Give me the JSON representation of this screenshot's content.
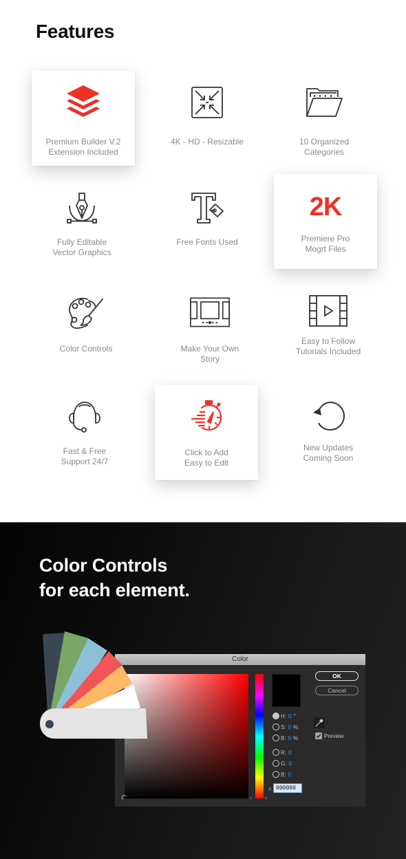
{
  "features": {
    "title": "Features",
    "items": [
      {
        "icon": "layers-icon",
        "lines": [
          "Premium Builder V.2",
          "Extension Included"
        ],
        "highlighted": true
      },
      {
        "icon": "resize-arrows-icon",
        "lines": [
          "4K - HD - Resizable"
        ],
        "highlighted": false
      },
      {
        "icon": "folder-icon",
        "lines": [
          "10 Organized",
          "Categories"
        ],
        "highlighted": false
      },
      {
        "icon": "pen-tool-icon",
        "lines": [
          "Fully Editable",
          "Vector Graphics"
        ],
        "highlighted": false
      },
      {
        "icon": "font-pen-icon",
        "lines": [
          "Free Fonts Used"
        ],
        "highlighted": false
      },
      {
        "icon": "2k-badge",
        "badge_text": "2K",
        "lines": [
          "Premiere Pro",
          "Mogrt Files"
        ],
        "highlighted": true
      },
      {
        "icon": "palette-icon",
        "lines": [
          "Color Controls"
        ],
        "highlighted": false
      },
      {
        "icon": "slideshow-icon",
        "lines": [
          "Make Your Own",
          "Story"
        ],
        "highlighted": false
      },
      {
        "icon": "film-play-icon",
        "lines": [
          "Easy to Follow",
          "Tutorials Included"
        ],
        "highlighted": false
      },
      {
        "icon": "headset-icon",
        "lines": [
          "Fast & Free",
          "Support 24/7"
        ],
        "highlighted": false
      },
      {
        "icon": "stopwatch-icon",
        "lines": [
          "Click to Add",
          "Easy to Edit"
        ],
        "highlighted": true
      },
      {
        "icon": "refresh-icon",
        "lines": [
          "New Updates",
          "Coming Soon"
        ],
        "highlighted": false
      }
    ]
  },
  "colors": {
    "accent": "#ee3127",
    "label_gray": "#8a8a8a",
    "swatches": [
      "#3a4654",
      "#7aa766",
      "#8cc0d8",
      "#f25555",
      "#ffb866",
      "#ffffff",
      "#e4e4e4"
    ]
  },
  "color_section": {
    "title_lines": [
      "Color Controls",
      "for each element."
    ]
  },
  "color_dialog": {
    "title": "Color",
    "ok_label": "OK",
    "cancel_label": "Cancel",
    "hsb": [
      {
        "label": "H:",
        "value": "0",
        "unit": "°",
        "checked": true
      },
      {
        "label": "S:",
        "value": "0",
        "unit": "%",
        "checked": false
      },
      {
        "label": "B:",
        "value": "0",
        "unit": "%",
        "checked": false
      }
    ],
    "rgb": [
      {
        "label": "R:",
        "value": "0",
        "checked": false
      },
      {
        "label": "G:",
        "value": "0",
        "checked": false
      },
      {
        "label": "B:",
        "value": "0",
        "checked": false
      }
    ],
    "hash_label": "#",
    "hex_value": "000000",
    "preview_label": "Preview",
    "preview_checked": true,
    "current_color": "#000000"
  }
}
